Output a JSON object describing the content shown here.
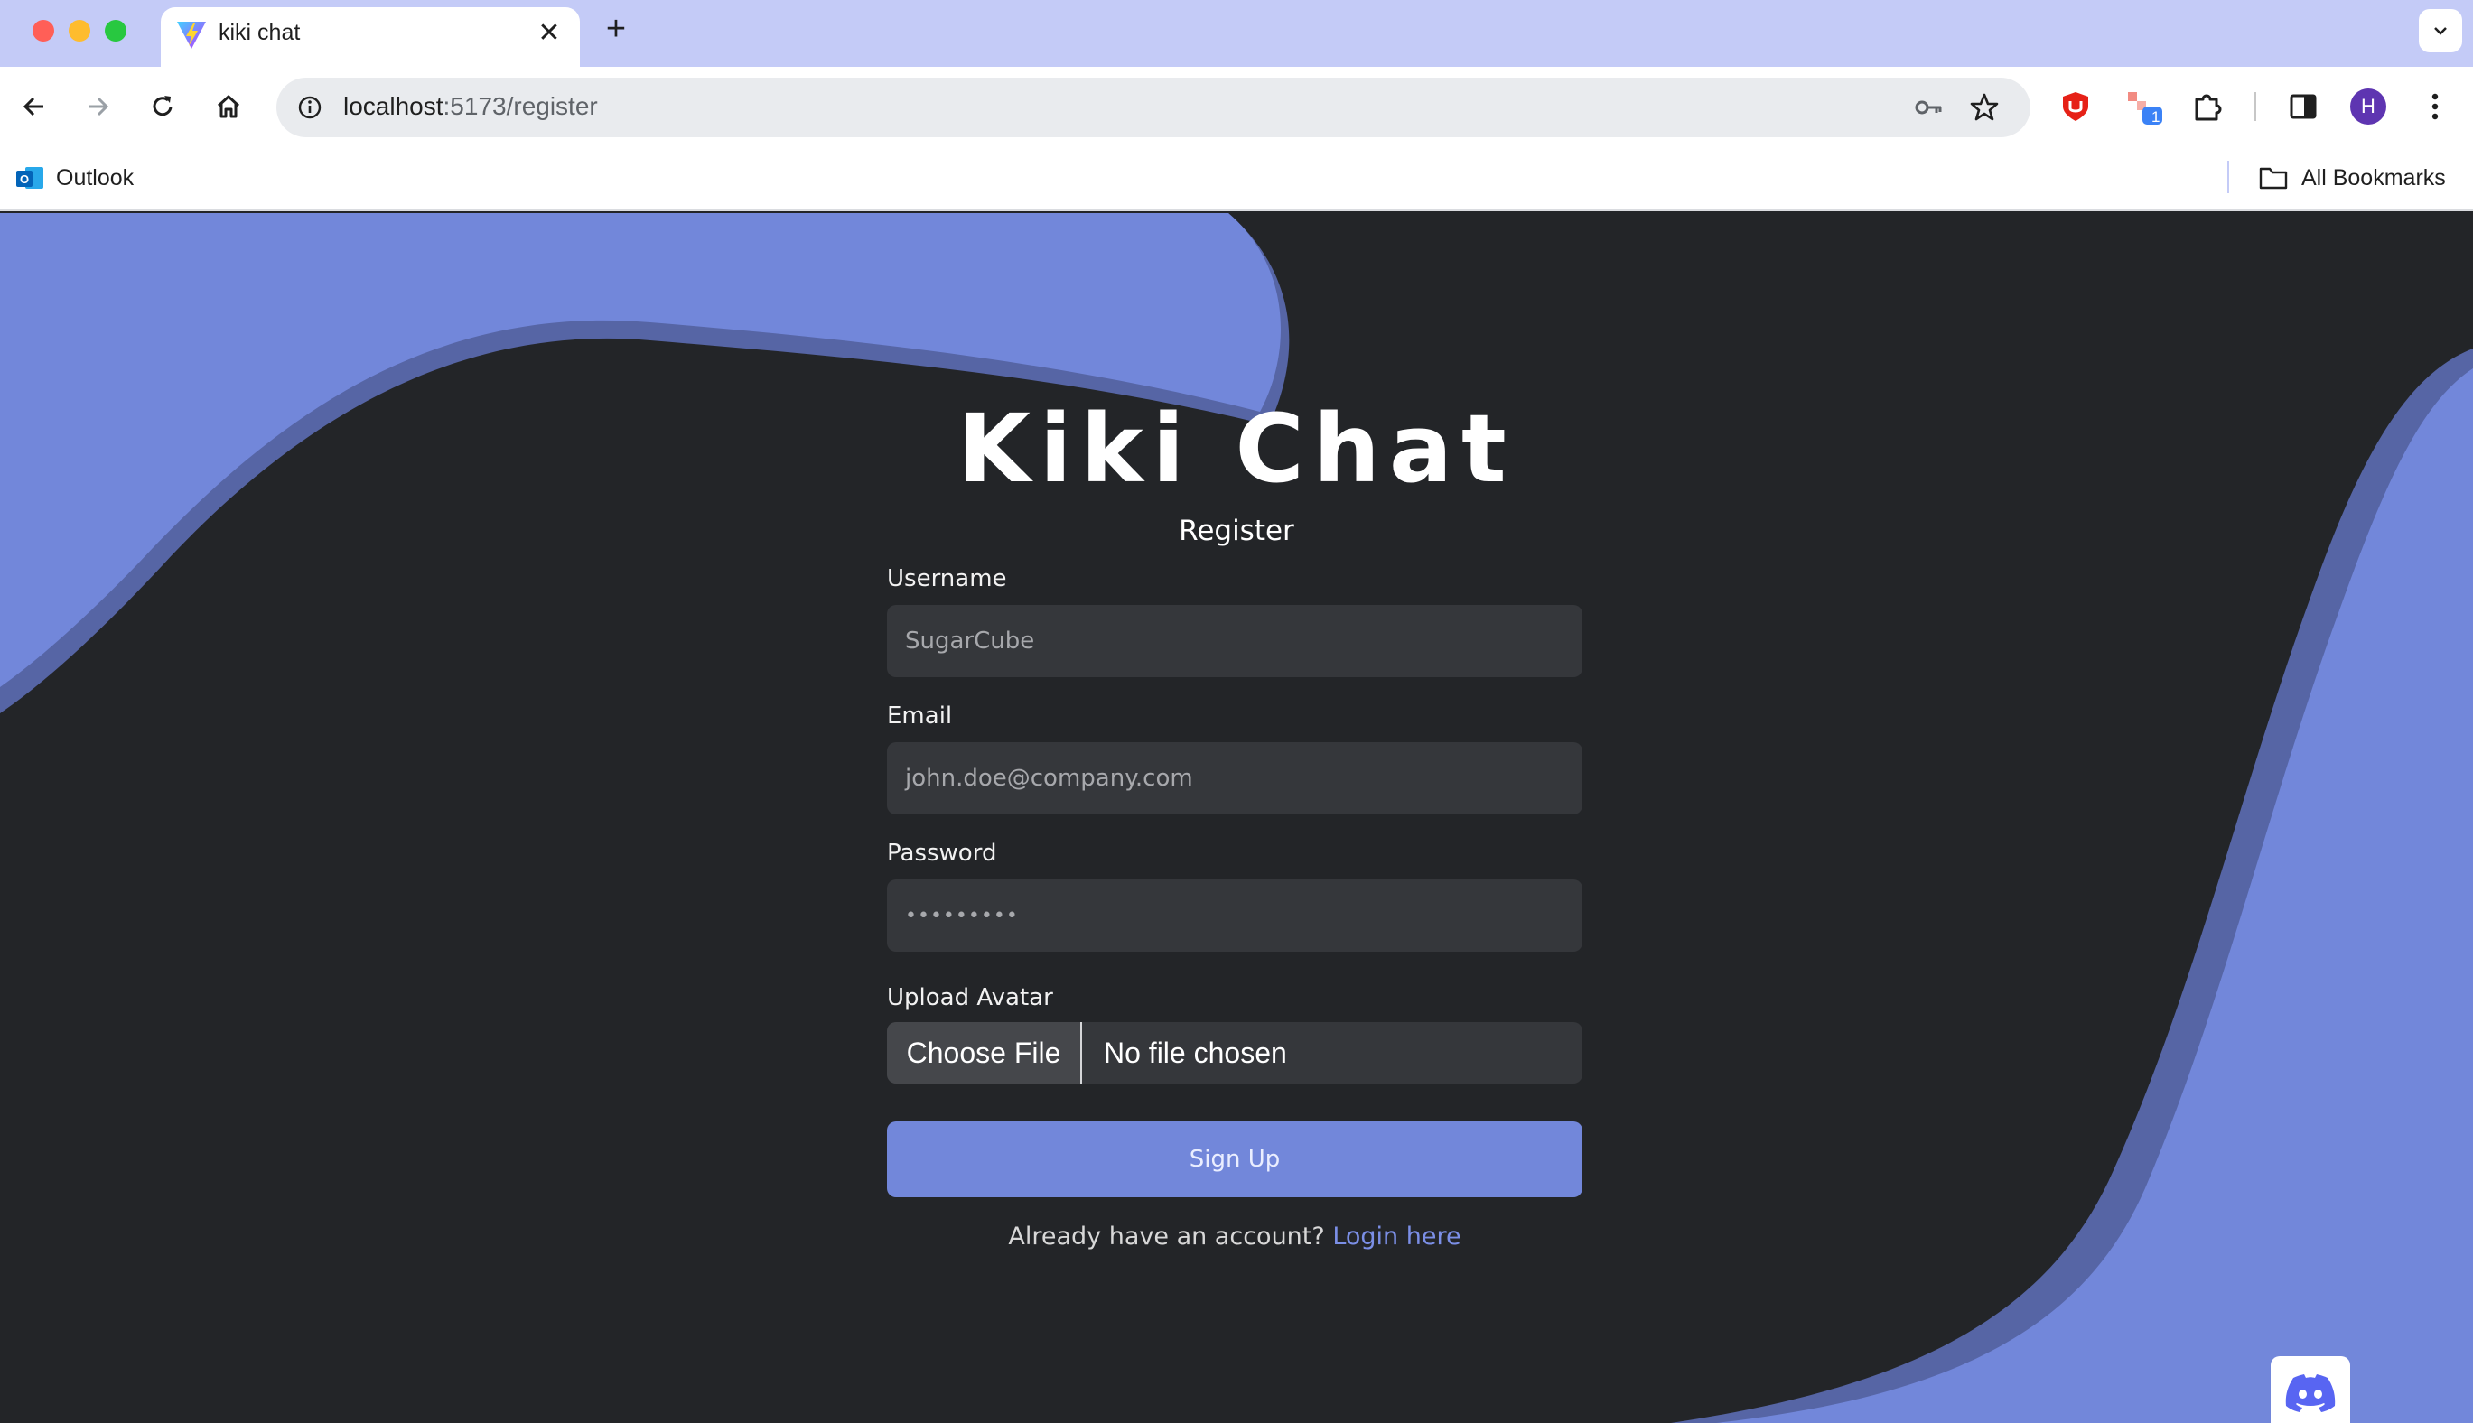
{
  "browser": {
    "tab": {
      "title": "kiki chat",
      "favicon": "vite-logo-icon"
    },
    "new_tab": "+",
    "url": {
      "host": "localhost",
      "path": ":5173/register"
    },
    "profile_initial": "H",
    "extension_badge": "1",
    "bookmarks": [
      {
        "label": "Outlook",
        "icon": "outlook-icon"
      }
    ],
    "all_bookmarks": "All Bookmarks"
  },
  "page": {
    "app_title": "Kiki Chat",
    "subtitle": "Register",
    "fields": {
      "username": {
        "label": "Username",
        "placeholder": "SugarCube"
      },
      "email": {
        "label": "Email",
        "placeholder": "john.doe@company.com"
      },
      "password": {
        "label": "Password",
        "placeholder": "•••••••••"
      }
    },
    "avatar": {
      "label": "Upload Avatar",
      "button": "Choose File",
      "status": "No file chosen"
    },
    "submit": "Sign Up",
    "footer": {
      "text": "Already have an account?",
      "link": "Login here"
    }
  },
  "colors": {
    "accent": "#7287da",
    "accent_dark": "#5665a5",
    "background": "#232528",
    "field": "#35373b",
    "tabbar": "#c4cbf7"
  }
}
